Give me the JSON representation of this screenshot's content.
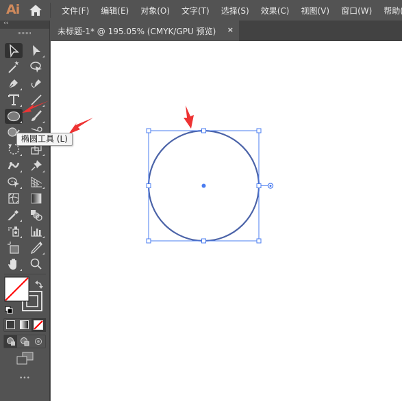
{
  "app": {
    "logo": "Ai",
    "brand_color": "#d08a5c"
  },
  "menu": {
    "items": [
      {
        "label": "文件(F)"
      },
      {
        "label": "编辑(E)"
      },
      {
        "label": "对象(O)"
      },
      {
        "label": "文字(T)"
      },
      {
        "label": "选择(S)"
      },
      {
        "label": "效果(C)"
      },
      {
        "label": "视图(V)"
      },
      {
        "label": "窗口(W)"
      },
      {
        "label": "帮助(H)"
      }
    ]
  },
  "document": {
    "tab_title": "未标题-1* @ 195.05% (CMYK/GPU 预览)",
    "close_label": "×"
  },
  "toolbar": {
    "collapse_label": "‹‹",
    "tools": [
      {
        "name": "selection-tool",
        "icon": "selection-arrow-icon",
        "active": true
      },
      {
        "name": "direct-selection-tool",
        "icon": "direct-selection-icon"
      },
      {
        "name": "magic-wand-tool",
        "icon": "magic-wand-icon"
      },
      {
        "name": "lasso-tool",
        "icon": "lasso-icon"
      },
      {
        "name": "pen-tool",
        "icon": "pen-icon"
      },
      {
        "name": "curvature-tool",
        "icon": "curvature-pen-icon"
      },
      {
        "name": "type-tool",
        "icon": "type-icon"
      },
      {
        "name": "line-segment-tool",
        "icon": "line-segment-icon"
      },
      {
        "name": "ellipse-tool",
        "icon": "ellipse-icon",
        "active": true
      },
      {
        "name": "paintbrush-tool",
        "icon": "paintbrush-icon"
      },
      {
        "name": "shaper-tool",
        "icon": "shaper-icon"
      },
      {
        "name": "scissors-tool",
        "icon": "scissors-icon"
      },
      {
        "name": "rotate-tool",
        "icon": "rotate-icon"
      },
      {
        "name": "free-transform-tool",
        "icon": "free-transform-icon"
      },
      {
        "name": "puppet-warp-tool",
        "icon": "puppet-warp-icon"
      },
      {
        "name": "pin-tool",
        "icon": "pin-icon"
      },
      {
        "name": "shape-builder-tool",
        "icon": "shape-builder-icon"
      },
      {
        "name": "perspective-grid-tool",
        "icon": "perspective-grid-icon"
      },
      {
        "name": "mesh-tool",
        "icon": "mesh-icon"
      },
      {
        "name": "gradient-tool",
        "icon": "gradient-icon"
      },
      {
        "name": "eyedropper-tool",
        "icon": "eyedropper-icon"
      },
      {
        "name": "blend-tool",
        "icon": "blend-icon"
      },
      {
        "name": "symbol-sprayer-tool",
        "icon": "symbol-sprayer-icon"
      },
      {
        "name": "column-graph-tool",
        "icon": "column-graph-icon"
      },
      {
        "name": "artboard-tool",
        "icon": "artboard-icon"
      },
      {
        "name": "knife-tool",
        "icon": "knife-icon"
      },
      {
        "name": "hand-tool",
        "icon": "hand-icon"
      },
      {
        "name": "zoom-tool",
        "icon": "zoom-icon"
      }
    ],
    "tooltip": "椭圆工具 (L)",
    "fill_color": "none",
    "stroke_color": "none",
    "more_label": "•••"
  },
  "colors": {
    "selection": "#4a7cf0",
    "annotation_arrow": "#ee3333",
    "none_slash": "#ff0000"
  }
}
